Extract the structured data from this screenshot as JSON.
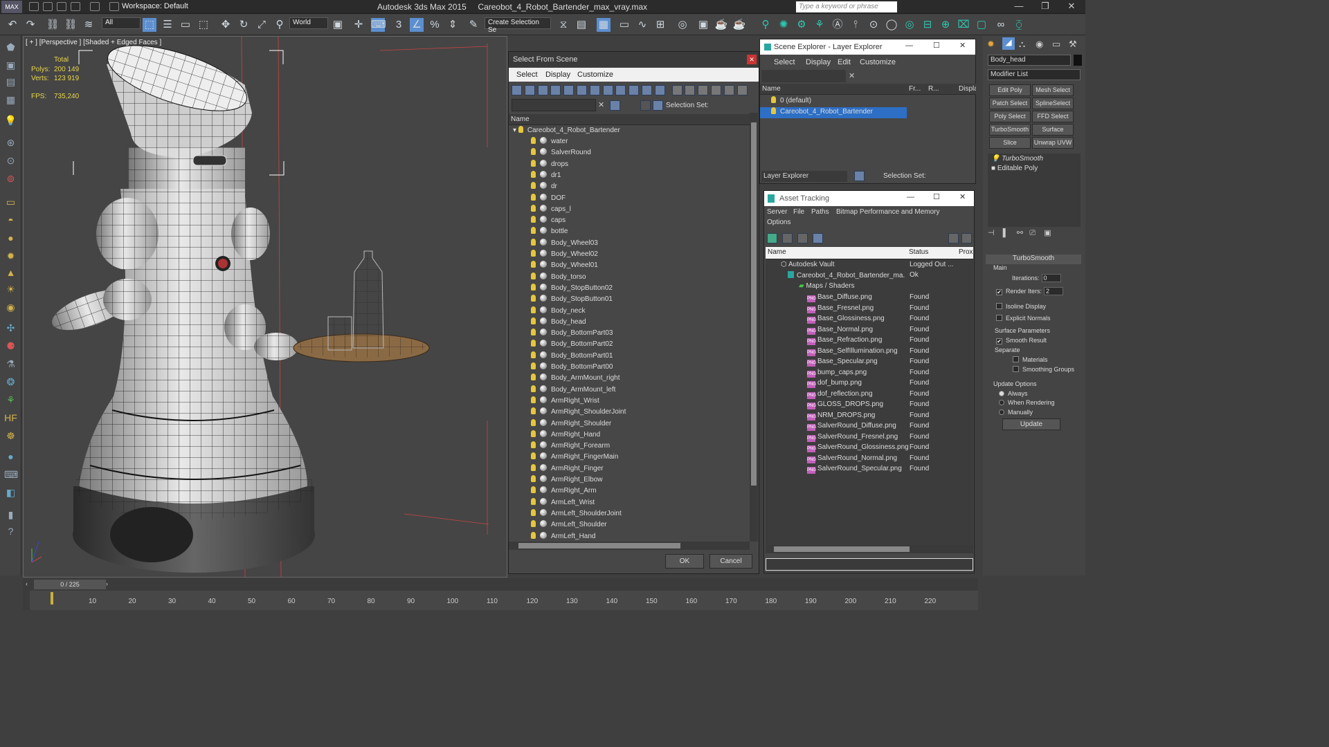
{
  "titlebar": {
    "app_title": "Autodesk 3ds Max  2015",
    "file_name": "Careobot_4_Robot_Bartender_max_vray.max",
    "workspace": "Workspace: Default",
    "search_placeholder": "Type a keyword or phrase"
  },
  "toolbar": {
    "filter_value": "All",
    "ref_coord": "World",
    "selection_set": "Create Selection Se"
  },
  "viewport": {
    "label": "[ + ] [Perspective ] [Shaded + Edged Faces ]",
    "total_label": "Total",
    "polys_label": "Polys:",
    "polys_value": "200 149",
    "verts_label": "Verts:",
    "verts_value": "123 919",
    "fps_label": "FPS:",
    "fps_value": "735,240"
  },
  "select_from_scene": {
    "title": "Select From Scene",
    "menu": [
      "Select",
      "Display",
      "Customize"
    ],
    "selection_set_label": "Selection Set:",
    "col_name": "Name",
    "root": "Careobot_4_Robot_Bartender",
    "items": [
      "water",
      "SalverRound",
      "drops",
      "dr1",
      "dr",
      "DOF",
      "caps_l",
      "caps",
      "bottle",
      "Body_Wheel03",
      "Body_Wheel02",
      "Body_Wheel01",
      "Body_torso",
      "Body_StopButton02",
      "Body_StopButton01",
      "Body_neck",
      "Body_head",
      "Body_BottomPart03",
      "Body_BottomPart02",
      "Body_BottomPart01",
      "Body_BottomPart00",
      "Body_ArmMount_right",
      "Body_ArmMount_left",
      "ArmRight_Wrist",
      "ArmRight_ShoulderJoint",
      "ArmRight_Shoulder",
      "ArmRight_Hand",
      "ArmRight_Forearm",
      "ArmRight_FingerMain",
      "ArmRight_Finger",
      "ArmRight_Elbow",
      "ArmRight_Arm",
      "ArmLeft_Wrist",
      "ArmLeft_ShoulderJoint",
      "ArmLeft_Shoulder",
      "ArmLeft_Hand"
    ],
    "ok": "OK",
    "cancel": "Cancel"
  },
  "scene_explorer": {
    "title": "Scene Explorer - Layer Explorer",
    "menu": [
      "Select",
      "Display",
      "Edit",
      "Customize"
    ],
    "cols": [
      "Name",
      "Fr...",
      "R...",
      "Displa..."
    ],
    "layers": [
      "0 (default)",
      "Careobot_4_Robot_Bartender"
    ],
    "footer_combo": "Layer Explorer",
    "footer_sel": "Selection Set:"
  },
  "asset_tracking": {
    "title": "Asset Tracking",
    "menu": [
      "Server",
      "File",
      "Paths",
      "Bitmap Performance and Memory",
      "Options"
    ],
    "cols": [
      "Name",
      "Status",
      "Prox"
    ],
    "vault": {
      "name": "Autodesk Vault",
      "status": "Logged Out ..."
    },
    "file": {
      "name": "Careobot_4_Robot_Bartender_ma...",
      "status": "Ok"
    },
    "folder": "Maps / Shaders",
    "maps": [
      {
        "name": "Base_Diffuse.png",
        "status": "Found"
      },
      {
        "name": "Base_Fresnel.png",
        "status": "Found"
      },
      {
        "name": "Base_Glossiness.png",
        "status": "Found"
      },
      {
        "name": "Base_Normal.png",
        "status": "Found"
      },
      {
        "name": "Base_Refraction.png",
        "status": "Found"
      },
      {
        "name": "Base_SelfIllumination.png",
        "status": "Found"
      },
      {
        "name": "Base_Specular.png",
        "status": "Found"
      },
      {
        "name": "bump_caps.png",
        "status": "Found"
      },
      {
        "name": "dof_bump.png",
        "status": "Found"
      },
      {
        "name": "dof_reflection.png",
        "status": "Found"
      },
      {
        "name": "GLOSS_DROPS.png",
        "status": "Found"
      },
      {
        "name": "NRM_DROPS.png",
        "status": "Found"
      },
      {
        "name": "SalverRound_Diffuse.png",
        "status": "Found"
      },
      {
        "name": "SalverRound_Fresnel.png",
        "status": "Found"
      },
      {
        "name": "SalverRound_Glossiness.png",
        "status": "Found"
      },
      {
        "name": "SalverRound_Normal.png",
        "status": "Found"
      },
      {
        "name": "SalverRound_Specular.png",
        "status": "Found"
      }
    ]
  },
  "command_panel": {
    "object_name": "Body_head",
    "modifier_list": "Modifier List",
    "buttons": [
      "Edit Poly",
      "Mesh Select",
      "Patch Select",
      "SplineSelect",
      "Poly Select",
      "FFD Select",
      "TurboSmooth",
      "Surface Select",
      "Slice",
      "Unwrap UVW"
    ],
    "stack": [
      "TurboSmooth",
      "Editable Poly"
    ],
    "rollout_title": "TurboSmooth",
    "main_label": "Main",
    "iterations_label": "Iterations:",
    "iterations_value": "0",
    "render_iters_label": "Render Iters:",
    "render_iters_value": "2",
    "isoline": "Isoline Display",
    "explicit": "Explicit Normals",
    "surface_params": "Surface Parameters",
    "smooth_result": "Smooth Result",
    "separate": "Separate",
    "materials": "Materials",
    "smoothing_groups": "Smoothing Groups",
    "update_options": "Update Options",
    "always": "Always",
    "when_rendering": "When Rendering",
    "manually": "Manually",
    "update": "Update"
  },
  "timeline": {
    "frame": "0 / 225",
    "ticks": [
      "10",
      "20",
      "30",
      "40",
      "50",
      "60",
      "70",
      "80",
      "90",
      "100",
      "110",
      "120",
      "130",
      "140",
      "150",
      "160",
      "170",
      "180",
      "190",
      "200",
      "210",
      "220"
    ]
  }
}
